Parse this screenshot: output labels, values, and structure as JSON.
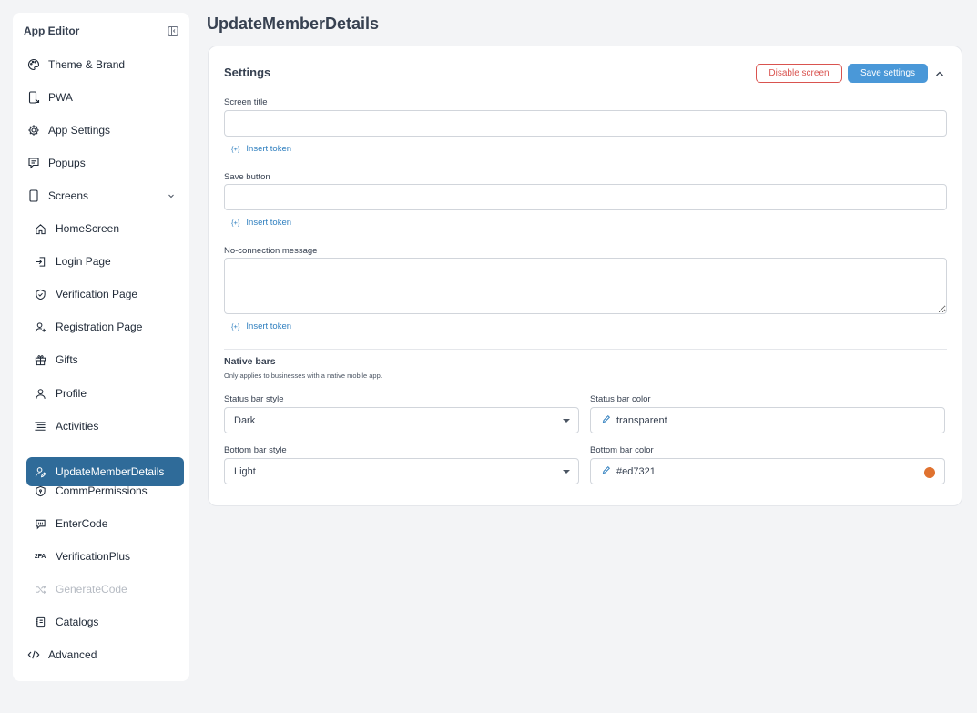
{
  "sidebar": {
    "title": "App Editor",
    "items": [
      {
        "label": "Theme & Brand",
        "icon": "palette-icon"
      },
      {
        "label": "PWA",
        "icon": "mobile-export-icon"
      },
      {
        "label": "App Settings",
        "icon": "settings-gear-icon"
      },
      {
        "label": "Popups",
        "icon": "chat-popup-icon"
      },
      {
        "label": "Screens",
        "icon": "phone-icon"
      },
      {
        "label": "HomeScreen",
        "icon": "home-icon"
      },
      {
        "label": "Login Page",
        "icon": "login-icon"
      },
      {
        "label": "Verification Page",
        "icon": "shield-check-icon"
      },
      {
        "label": "Registration Page",
        "icon": "user-plus-icon"
      },
      {
        "label": "Gifts",
        "icon": "gift-icon"
      },
      {
        "label": "Profile",
        "icon": "user-icon"
      },
      {
        "label": "Activities",
        "icon": "list-icon"
      },
      {
        "label": "UpdateMemberDetails",
        "icon": "user-edit-icon"
      },
      {
        "label": "CommPermissions",
        "icon": "shield-lock-icon"
      },
      {
        "label": "EnterCode",
        "icon": "code-bubble-icon"
      },
      {
        "label": "VerificationPlus",
        "icon": "2fa-icon",
        "icon_text": "2FA"
      },
      {
        "label": "GenerateCode",
        "icon": "shuffle-icon"
      },
      {
        "label": "Catalogs",
        "icon": "notebook-icon"
      },
      {
        "label": "Advanced",
        "icon": "code-icon"
      }
    ],
    "active_item": "UpdateMemberDetails",
    "disabled_item": "GenerateCode"
  },
  "page": {
    "title": "UpdateMemberDetails"
  },
  "settings": {
    "title": "Settings",
    "disable_label": "Disable screen",
    "save_label": "Save settings",
    "screen_title_label": "Screen title",
    "screen_title_value": "",
    "save_button_label": "Save button",
    "save_button_value": "",
    "no_connection_label": "No-connection message",
    "no_connection_value": "",
    "insert_token_icon": "{+}",
    "insert_token_label": "Insert token"
  },
  "native_bars": {
    "title": "Native bars",
    "note": "Only applies to businesses with a native mobile app.",
    "status_bar_style_label": "Status bar style",
    "status_bar_style_value": "Dark",
    "status_bar_color_label": "Status bar color",
    "status_bar_color_value": "transparent",
    "bottom_bar_style_label": "Bottom bar style",
    "bottom_bar_style_value": "Light",
    "bottom_bar_color_label": "Bottom bar color",
    "bottom_bar_color_value": "#ed7321",
    "bottom_bar_swatch": "#e0722f"
  },
  "colors": {
    "accent": "#4a98d8",
    "active_nav": "#2f6b99",
    "danger": "#d9534f",
    "link": "#2f7fbf"
  }
}
